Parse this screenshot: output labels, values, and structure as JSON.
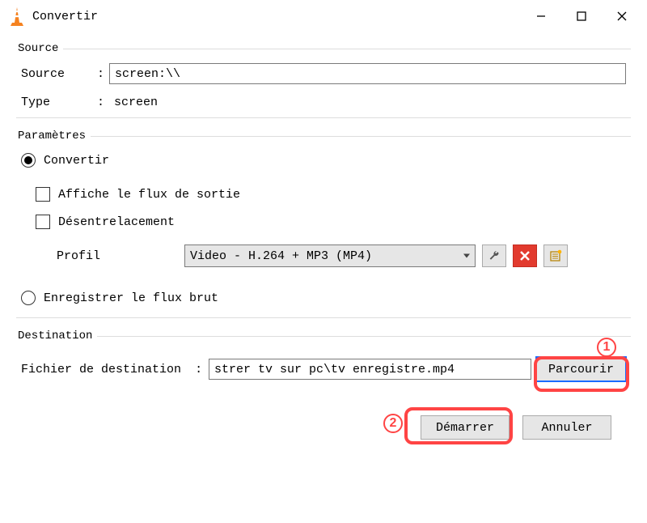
{
  "window": {
    "title": "Convertir"
  },
  "source_group": {
    "legend": "Source",
    "source_label": "Source",
    "source_value": "screen:\\\\",
    "type_label": "Type",
    "type_value": "screen"
  },
  "params_group": {
    "legend": "Paramètres",
    "convert_label": "Convertir",
    "show_output_label": "Affiche le flux de sortie",
    "deinterlace_label": "Désentrelacement",
    "profile_label": "Profil",
    "profile_value": "Video - H.264 + MP3 (MP4)",
    "raw_label": "Enregistrer le flux brut"
  },
  "dest_group": {
    "legend": "Destination",
    "dest_label": "Fichier de destination",
    "dest_value": "strer tv sur pc\\tv enregistre.mp4",
    "browse_label": "Parcourir"
  },
  "footer": {
    "start_label": "Démarrer",
    "cancel_label": "Annuler"
  },
  "callouts": {
    "one": "1",
    "two": "2"
  }
}
